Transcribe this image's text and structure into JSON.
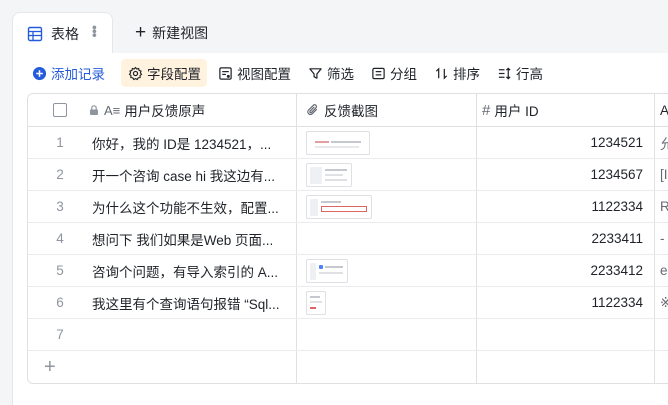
{
  "tabs": {
    "active_label": "表格",
    "new_view_label": "新建视图"
  },
  "toolbar": {
    "add_record": "添加记录",
    "field_config": "字段配置",
    "view_config": "视图配置",
    "filter": "筛选",
    "group": "分组",
    "sort": "排序",
    "row_height": "行高"
  },
  "columns": {
    "feedback": "用户反馈原声",
    "screenshot": "反馈截图",
    "user_id": "用户 ID",
    "extra": "A"
  },
  "rows": [
    {
      "num": "1",
      "feedback": "你好，我的 ID是 1234521，...",
      "has_image": true,
      "user_id": "1234521",
      "extra": "允"
    },
    {
      "num": "2",
      "feedback": "开一个咨询 case hi 我这边有...",
      "has_image": true,
      "user_id": "1234567",
      "extra": "[I"
    },
    {
      "num": "3",
      "feedback": "为什么这个功能不生效，配置...",
      "has_image": true,
      "user_id": "1122334",
      "extra": "R"
    },
    {
      "num": "4",
      "feedback": "想问下 我们如果是Web 页面...",
      "has_image": false,
      "user_id": "2233411",
      "extra": "-"
    },
    {
      "num": "5",
      "feedback": "咨询个问题，有导入索引的 A...",
      "has_image": true,
      "user_id": "2233412",
      "extra": "e"
    },
    {
      "num": "6",
      "feedback": "我这里有个查询语句报错 “Sql...",
      "has_image": true,
      "user_id": "1122334",
      "extra": "※"
    },
    {
      "num": "7",
      "feedback": "",
      "has_image": false,
      "user_id": "",
      "extra": ""
    }
  ],
  "colors": {
    "accent": "#245bdb",
    "active_tool_bg": "#fff3df"
  }
}
